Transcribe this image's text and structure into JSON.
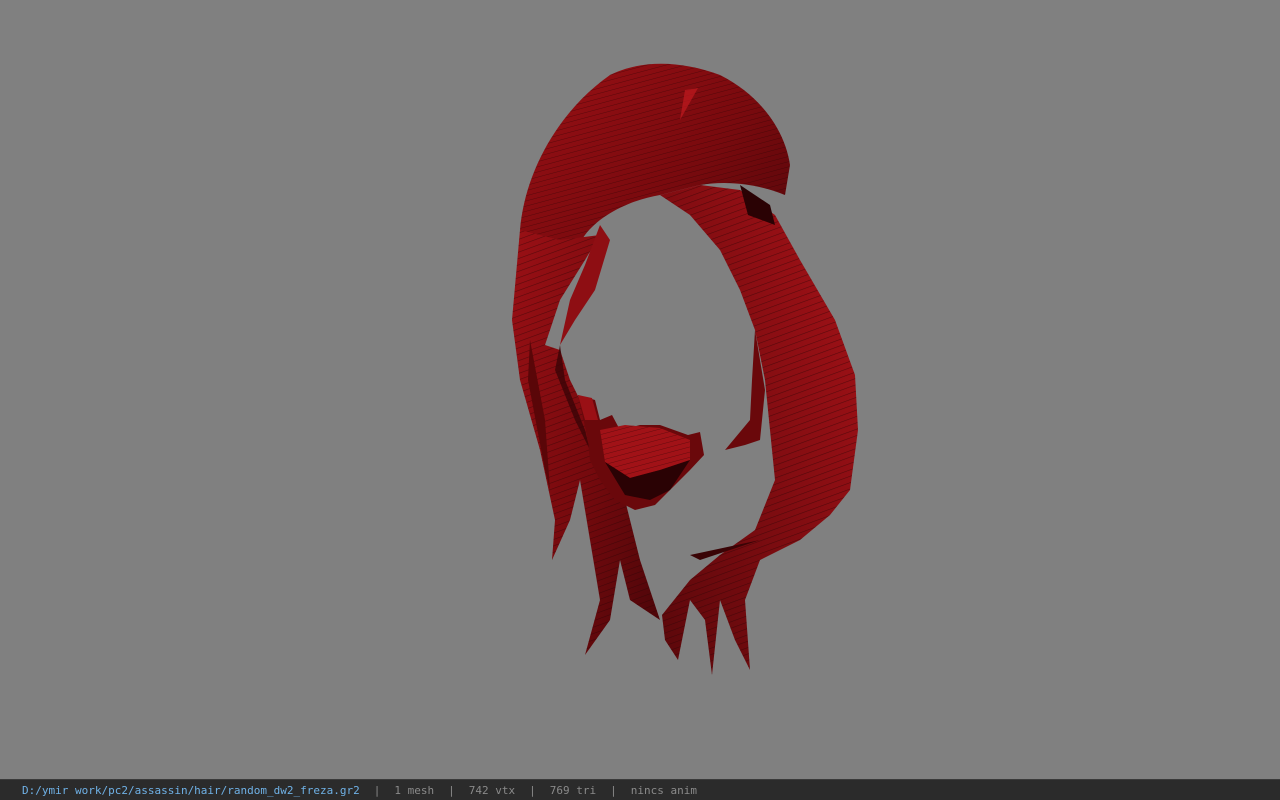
{
  "viewport": {
    "background_color": "#808080",
    "model": {
      "name": "hair-model",
      "base_color": "#8a0f12",
      "dark_color": "#3a0406",
      "highlight_color": "#b5151a"
    }
  },
  "status_bar": {
    "file_path": "D:/ymir work/pc2/assassin/hair/random_dw2_freza.gr2",
    "separator": "|",
    "mesh_count": "1 mesh",
    "vertex_count": "742 vtx",
    "triangle_count": "769 tri",
    "animation": "nincs anim"
  }
}
